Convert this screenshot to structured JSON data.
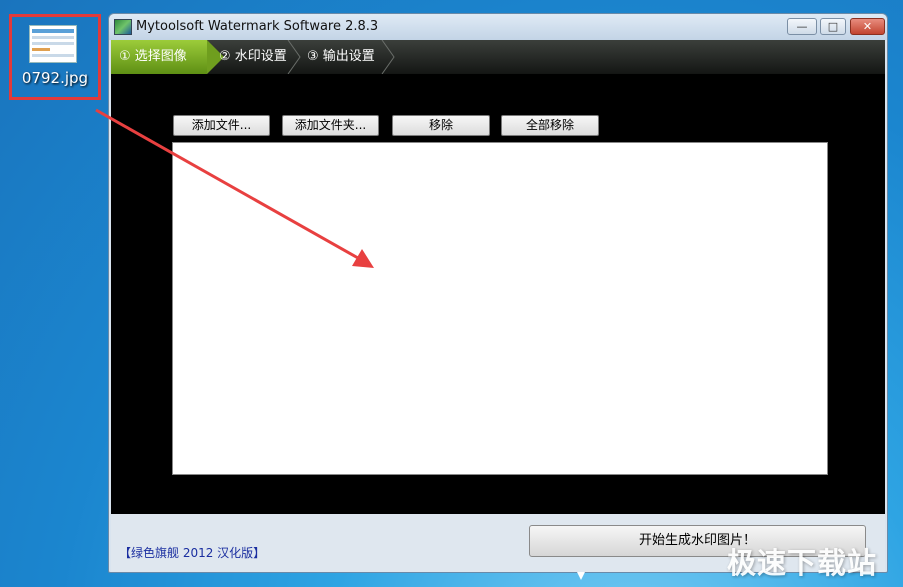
{
  "desktop": {
    "file_icon_label": "0792.jpg"
  },
  "window": {
    "title": "Mytoolsoft Watermark Software 2.8.3",
    "controls": {
      "minimize": "—",
      "maximize": "□",
      "close": "✕"
    }
  },
  "steps": [
    {
      "label": "① 选择图像",
      "active": true
    },
    {
      "label": "② 水印设置",
      "active": false
    },
    {
      "label": "③ 输出设置",
      "active": false
    }
  ],
  "toolbar": {
    "add_file": "添加文件...",
    "add_folder": "添加文件夹...",
    "remove": "移除",
    "remove_all": "全部移除"
  },
  "footer": {
    "note": "【绿色旗舰 2012 汉化版】",
    "generate": "开始生成水印图片！"
  },
  "watermark_text": "极速下载站",
  "colors": {
    "highlight_box": "#e23a3a",
    "arrow": "#e84040",
    "active_step": "#7fb02a",
    "footer_note": "#1a2ea0"
  }
}
